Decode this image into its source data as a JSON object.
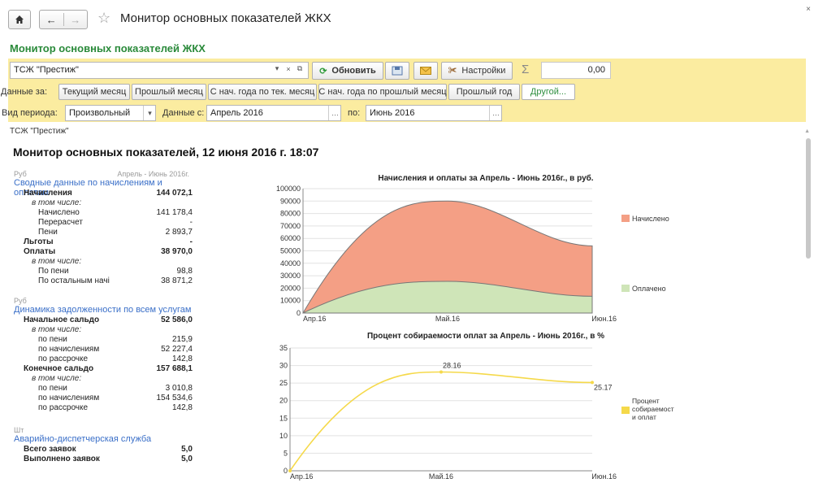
{
  "window": {
    "title": "Монитор основных показателей ЖКХ",
    "close_glyph": "×",
    "home_icon": "home-icon",
    "back_glyph": "←",
    "forward_glyph": "→",
    "star_glyph": "☆"
  },
  "form_title": "Монитор основных показателей ЖКХ",
  "toolbar": {
    "organization": "ТСЖ \"Престиж\"",
    "refresh_label": "Обновить",
    "settings_label": "Настройки",
    "sum_value": "0,00"
  },
  "period_row": {
    "label": "Данные за:",
    "buttons": [
      "Текущий месяц",
      "Прошлый месяц",
      "С нач. года по тек. месяц",
      "С нач. года по прошлый месяц",
      "Прошлый год",
      "Другой..."
    ]
  },
  "period_select": {
    "type_label": "Вид периода:",
    "type_value": "Произвольный",
    "from_label": "Данные с:",
    "from_value": "Апрель 2016",
    "to_label": "по:",
    "to_value": "Июнь 2016"
  },
  "org_caption": "ТСЖ \"Престиж\"",
  "report_title": "Монитор основных показателей, 12 июня 2016 г. 18:07",
  "sections": {
    "s1": {
      "unit": "Руб",
      "period": "Апрель - Июнь 2016г.",
      "title": "Сводные данные по начислениям и оплатам",
      "rows": [
        {
          "label": "Начисления",
          "value": "144 072,1"
        },
        {
          "label": "в том числе:",
          "value": ""
        },
        {
          "label": "Начислено",
          "value": "141 178,4"
        },
        {
          "label": "Перерасчет",
          "value": "-"
        },
        {
          "label": "Пени",
          "value": "2 893,7"
        },
        {
          "label": "Льготы",
          "value": "-"
        },
        {
          "label": "Оплаты",
          "value": "38 970,0"
        },
        {
          "label": "в том числе:",
          "value": ""
        },
        {
          "label": "По пени",
          "value": "98,8"
        },
        {
          "label": "По остальным начі",
          "value": "38 871,2"
        }
      ]
    },
    "s2": {
      "unit": "Руб",
      "title": "Динамика задолженности по всем услугам",
      "rows": [
        {
          "label": "Начальное сальдо",
          "value": "52 586,0"
        },
        {
          "label": "в том числе:",
          "value": ""
        },
        {
          "label": "по пени",
          "value": "215,9"
        },
        {
          "label": "по начислениям",
          "value": "52 227,4"
        },
        {
          "label": "по рассрочке",
          "value": "142,8"
        },
        {
          "label": "Конечное сальдо",
          "value": "157 688,1"
        },
        {
          "label": "в том числе:",
          "value": ""
        },
        {
          "label": "по пени",
          "value": "3 010,8"
        },
        {
          "label": "по начислениям",
          "value": "154 534,6"
        },
        {
          "label": "по рассрочке",
          "value": "142,8"
        }
      ]
    },
    "s3": {
      "unit": "Шт",
      "title": "Аварийно-диспетчерская служба",
      "rows": [
        {
          "label": "Всего заявок",
          "value": "5,0"
        },
        {
          "label": "Выполнено заявок",
          "value": "5,0"
        }
      ]
    }
  },
  "chart_data": [
    {
      "type": "area",
      "title": "Начисления и оплаты за Апрель - Июнь 2016г., в руб.",
      "categories": [
        "Апр.16",
        "Май.16",
        "Июн.16"
      ],
      "ylim": [
        0,
        100000
      ],
      "yticks": [
        "0",
        "10000",
        "20000",
        "30000",
        "40000",
        "50000",
        "60000",
        "70000",
        "80000",
        "90000",
        "100000"
      ],
      "series": [
        {
          "name": "Начислено",
          "values": [
            0,
            90000,
            54000
          ],
          "color": "#f49f85"
        },
        {
          "name": "Оплачено",
          "values": [
            0,
            25500,
            13500
          ],
          "color": "#cfe5b8"
        }
      ],
      "legend": "right"
    },
    {
      "type": "line",
      "title": "Процент собираемости оплат за Апрель - Июнь 2016г., в %",
      "categories": [
        "Апр.16",
        "Май.16",
        "Июн.16"
      ],
      "ylim": [
        0,
        35
      ],
      "yticks": [
        "0",
        "5",
        "10",
        "15",
        "20",
        "25",
        "30",
        "35"
      ],
      "series": [
        {
          "name": "Процент собираемост и оплат",
          "values": [
            0,
            28.16,
            25.17
          ],
          "labels": [
            "",
            "28.16",
            "25.17"
          ],
          "color": "#f5d94a"
        }
      ],
      "legend": "right"
    }
  ]
}
